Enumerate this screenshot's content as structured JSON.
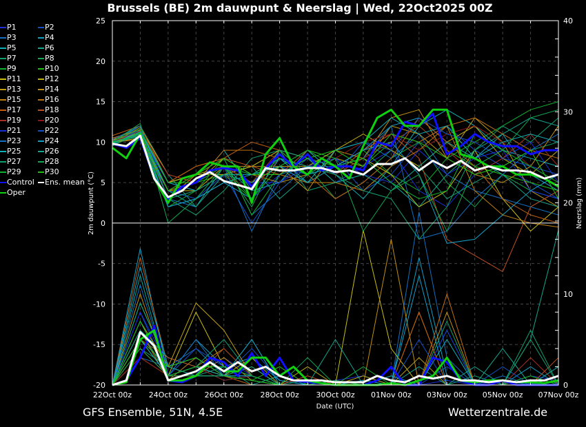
{
  "chart_data": {
    "type": "line",
    "title": "Brussels  (BE)  2m dauwpunt & Neerslag | Wed, 22Oct2025 00Z",
    "xlabel": "Date (UTC)",
    "ylabel": "2m dauwpunt (°C)",
    "y2label": "Neerslag (mm)",
    "ylim": [
      -20,
      25
    ],
    "y2lim": [
      0,
      40
    ],
    "yticks": [
      25,
      20,
      15,
      10,
      5,
      0,
      -5,
      -10,
      -15,
      -20
    ],
    "y2ticks": [
      40,
      30,
      20,
      10,
      0
    ],
    "xticks": [
      "22Oct 00z",
      "24Oct 00z",
      "26Oct 00z",
      "28Oct 00z",
      "30Oct 00z",
      "01Nov 00z",
      "03Nov 00z",
      "05Nov 00z",
      "07Nov 00z"
    ],
    "days": 16,
    "grid": true,
    "legend_position": "left-outside",
    "members": {
      "time_step_h": 24,
      "names": [
        "P1",
        "P2",
        "P3",
        "P4",
        "P5",
        "P6",
        "P7",
        "P8",
        "P9",
        "P10",
        "P11",
        "P12",
        "P13",
        "P14",
        "P15",
        "P16",
        "P17",
        "P18",
        "P19",
        "P20",
        "P21",
        "P22",
        "P23",
        "P24",
        "P25",
        "P26",
        "P27",
        "P28",
        "P29",
        "P30"
      ],
      "colors": [
        "#1a2fd8",
        "#1450c8",
        "#1470c0",
        "#12a0c8",
        "#10b0b8",
        "#10a890",
        "#10a070",
        "#10a850",
        "#10b030",
        "#20c018",
        "#c8c010",
        "#c0b010",
        "#c0a010",
        "#c09010",
        "#c08010",
        "#c07010",
        "#c06010",
        "#c05020",
        "#a83020",
        "#901818",
        "#1a2fd8",
        "#1450c8",
        "#1470c0",
        "#12a0c8",
        "#10b0b8",
        "#10a890",
        "#10a070",
        "#10a850",
        "#10b030",
        "#20c018"
      ],
      "dewpoint": [
        [
          10,
          11,
          4,
          5,
          7,
          3,
          6,
          8,
          5,
          7,
          9,
          4,
          2,
          6,
          8,
          10,
          5
        ],
        [
          10.2,
          11.5,
          3,
          4,
          6,
          5,
          7,
          6,
          8,
          4,
          6,
          10,
          12,
          9,
          7,
          5,
          3
        ],
        [
          9.8,
          12,
          5,
          6,
          8,
          1,
          4,
          7,
          9,
          10,
          8,
          11,
          6,
          4,
          3,
          2,
          1
        ],
        [
          10,
          10.5,
          2,
          3,
          5,
          6,
          8,
          5,
          7,
          9,
          12,
          13,
          10,
          8,
          11,
          6,
          4
        ],
        [
          9.9,
          11,
          4,
          5,
          9,
          4,
          5,
          9,
          6,
          3,
          7,
          12,
          14,
          12,
          9,
          8,
          7
        ],
        [
          10.1,
          12,
          6,
          2,
          6,
          7,
          3,
          6,
          7,
          8,
          5,
          2,
          6,
          9,
          11,
          13,
          12
        ],
        [
          9.7,
          11.2,
          3,
          1,
          4,
          8,
          9,
          4,
          5,
          6,
          9,
          7,
          3,
          5,
          7,
          9,
          10
        ],
        [
          10,
          10.8,
          5,
          6,
          7,
          6,
          8,
          7,
          3,
          5,
          8,
          10,
          5,
          2,
          6,
          4,
          3
        ],
        [
          9.5,
          11.5,
          2,
          4,
          8,
          1,
          6,
          8,
          7,
          9,
          6,
          4,
          8,
          10,
          12,
          14,
          15
        ],
        [
          10,
          11,
          4,
          5,
          6,
          3,
          7,
          9,
          8,
          7,
          10,
          12,
          9,
          7,
          6,
          5,
          4
        ],
        [
          10.3,
          11,
          5,
          6,
          6,
          7,
          9,
          8,
          6,
          8,
          6,
          2,
          4,
          9,
          3,
          -1,
          2
        ],
        [
          10,
          10.5,
          4,
          4,
          7,
          5,
          7,
          7,
          9,
          11,
          9,
          7,
          10,
          12,
          8,
          6,
          9
        ],
        [
          9.8,
          11.8,
          6,
          5,
          8,
          6,
          5,
          6,
          8,
          7,
          12,
          11,
          8,
          13,
          10,
          4,
          2
        ],
        [
          10.2,
          11,
          3,
          6,
          7,
          7,
          7,
          4,
          9,
          8,
          13,
          14,
          8,
          6,
          5,
          7,
          12
        ],
        [
          10.5,
          11.5,
          5,
          7,
          8,
          6,
          6,
          5,
          5,
          4,
          7,
          9,
          12,
          4,
          1,
          0,
          -0.5
        ],
        [
          10,
          10.3,
          4,
          5,
          9,
          9,
          8,
          7,
          6,
          9,
          11,
          10,
          12,
          13,
          11,
          9,
          8
        ],
        [
          10.8,
          12,
          5,
          7,
          8,
          10,
          9,
          6,
          3,
          5,
          8,
          13,
          10,
          7,
          3,
          1,
          0
        ],
        [
          10.5,
          11,
          4,
          6,
          8,
          7,
          6,
          9,
          7,
          9,
          11,
          8,
          -2,
          -4,
          -6,
          2,
          4
        ],
        [
          10,
          11.4,
          6,
          5,
          7,
          5,
          9,
          8,
          6,
          8,
          10,
          12,
          9,
          6,
          8,
          11,
          7
        ],
        [
          10.2,
          10.9,
          3,
          4,
          6,
          4,
          8,
          7,
          8,
          10,
          11,
          9,
          11,
          12,
          10,
          7,
          5
        ],
        [
          10,
          11,
          5,
          4,
          6,
          5,
          5,
          7,
          8,
          6,
          5,
          9,
          6,
          8,
          9,
          4,
          3
        ],
        [
          9.7,
          11.6,
          4,
          3,
          6,
          0,
          5,
          8,
          6,
          10,
          9,
          13,
          11,
          10,
          8,
          7,
          6
        ],
        [
          10.3,
          12,
          3,
          2,
          7,
          -1,
          6,
          7,
          7,
          8,
          12,
          -2,
          -1,
          3,
          6,
          9,
          11
        ],
        [
          10,
          11,
          2,
          3,
          5,
          3,
          8,
          6,
          7,
          9,
          10,
          6,
          -2.5,
          -2,
          1,
          4,
          6
        ],
        [
          9.8,
          11.3,
          5,
          4,
          6,
          6,
          7,
          5,
          9,
          10,
          13,
          11,
          12,
          8,
          10,
          11,
          10
        ],
        [
          10,
          10.7,
          4,
          2,
          7,
          4,
          9,
          8,
          5,
          6,
          4,
          7,
          10,
          8,
          6,
          3,
          2
        ],
        [
          9.6,
          11,
          3,
          4,
          6,
          5,
          8,
          7,
          6,
          4,
          3,
          -2,
          2,
          9,
          12,
          10,
          13
        ],
        [
          10,
          12.3,
          0,
          3,
          7,
          2,
          9,
          6,
          8,
          -1,
          4,
          6,
          -1,
          7,
          9,
          13,
          14
        ],
        [
          10.1,
          11.6,
          5,
          5,
          7,
          3,
          7,
          9,
          7,
          8,
          5,
          3,
          4,
          11,
          9,
          7,
          5
        ],
        [
          9.9,
          11.1,
          4,
          6,
          8,
          6,
          6,
          8,
          9,
          7,
          11,
          10,
          8,
          6,
          7,
          9,
          3
        ]
      ],
      "precip": [
        [
          0,
          5,
          2,
          1,
          3,
          1,
          0,
          0,
          0.5,
          1,
          0,
          0,
          0.5,
          0,
          0,
          1,
          0.5
        ],
        [
          0,
          8,
          1,
          2,
          1,
          4,
          0.5,
          0,
          0,
          0,
          1,
          0,
          2,
          0,
          0.5,
          0,
          0
        ],
        [
          0,
          3,
          2,
          4,
          1,
          0.5,
          0,
          0,
          0.5,
          0,
          0,
          19,
          3,
          0,
          1,
          0,
          0.5
        ],
        [
          0,
          15,
          1,
          5,
          2,
          3,
          0.5,
          0,
          0,
          0.5,
          0,
          14,
          1,
          0,
          0,
          2,
          0
        ],
        [
          0,
          6,
          3,
          2,
          0.5,
          1,
          0,
          0,
          0,
          0,
          1,
          0,
          5,
          0,
          0,
          0,
          1
        ],
        [
          0,
          12,
          1,
          1,
          2,
          0,
          1,
          0,
          0,
          0,
          0,
          2,
          0,
          0,
          4,
          0,
          0
        ],
        [
          0,
          4,
          2,
          1,
          1,
          5,
          0,
          0.5,
          0,
          0,
          0,
          0,
          0,
          1,
          0,
          6,
          0
        ],
        [
          0,
          6,
          0.5,
          3,
          1,
          2,
          0,
          0,
          0.5,
          0,
          0,
          0,
          0,
          0,
          0,
          0,
          0
        ],
        [
          0,
          9,
          2,
          1,
          4,
          1,
          0,
          0,
          0,
          2,
          0,
          0,
          6,
          0,
          0,
          0,
          0.5
        ],
        [
          0,
          7,
          1,
          2,
          1,
          0.5,
          2,
          0,
          0,
          0,
          0,
          0,
          0,
          0,
          0,
          1,
          0
        ],
        [
          0,
          3,
          1,
          8,
          2,
          1,
          0,
          0,
          0,
          17,
          4,
          0,
          0,
          0,
          0,
          0,
          0
        ],
        [
          0,
          5,
          1,
          2,
          1,
          3,
          0,
          2,
          0,
          1,
          0,
          0,
          0,
          0,
          0,
          0,
          0
        ],
        [
          0,
          7,
          2,
          9,
          6,
          1,
          0,
          0,
          0,
          0,
          0,
          3,
          0,
          0,
          0,
          0,
          0
        ],
        [
          0,
          10,
          1,
          1,
          3,
          0.5,
          0,
          0,
          0,
          0,
          16,
          0,
          8,
          0,
          0,
          0,
          0
        ],
        [
          0,
          4,
          1,
          2,
          4,
          1,
          0,
          0,
          0,
          0,
          0,
          8,
          0,
          0,
          0,
          0,
          0
        ],
        [
          0,
          6,
          0.5,
          3,
          1,
          2,
          0,
          0,
          0,
          0,
          0,
          0,
          10,
          0,
          0,
          0,
          0
        ],
        [
          0,
          14,
          2,
          1,
          1,
          0,
          0,
          0,
          0,
          0,
          0,
          8,
          0,
          0,
          0,
          0,
          0
        ],
        [
          0,
          5,
          3,
          2,
          1,
          0.5,
          0,
          1,
          0,
          0,
          0,
          0,
          0,
          0,
          0,
          0,
          3
        ],
        [
          0,
          4,
          1,
          1,
          4,
          1,
          0,
          0,
          0,
          0,
          0,
          0,
          0,
          0,
          0,
          3,
          0
        ],
        [
          0,
          3,
          1,
          2,
          0.5,
          1,
          0,
          0,
          0,
          0,
          0,
          0,
          0,
          0,
          0,
          0,
          0
        ],
        [
          0,
          8,
          2,
          1,
          1,
          1,
          0,
          0,
          0,
          0,
          0,
          0,
          6,
          0,
          0,
          0,
          0
        ],
        [
          0,
          6,
          1,
          4,
          2,
          1,
          0,
          0,
          0,
          0,
          0,
          5,
          0,
          0,
          2,
          0,
          0
        ],
        [
          0,
          11,
          1,
          5,
          1,
          0.5,
          0,
          0,
          0,
          0,
          0,
          0,
          0,
          0,
          0,
          0,
          0
        ],
        [
          0,
          13,
          2,
          3,
          1,
          5,
          0,
          0,
          0,
          0,
          0,
          12,
          0,
          0,
          0,
          0,
          1
        ],
        [
          0,
          5,
          1,
          2,
          1,
          1,
          0,
          0,
          0,
          0,
          0,
          0,
          0,
          0,
          0,
          0,
          2
        ],
        [
          0,
          9,
          2,
          1,
          1,
          2,
          0,
          0,
          5,
          0,
          0,
          0,
          0,
          2,
          0,
          5,
          17
        ],
        [
          0,
          6,
          1,
          2,
          5,
          1,
          0,
          0,
          0,
          0,
          0,
          0,
          7,
          0,
          0,
          5,
          0
        ],
        [
          0,
          4,
          1,
          1,
          1,
          0.5,
          0,
          3,
          0,
          0,
          0,
          0,
          0,
          0,
          0,
          0,
          0
        ],
        [
          0,
          7,
          1,
          2,
          2,
          1,
          0,
          0,
          0,
          0,
          0,
          0,
          0,
          0,
          0,
          0,
          1
        ],
        [
          0,
          5,
          2,
          3,
          1,
          0.5,
          0,
          0,
          0,
          0,
          0,
          0,
          0,
          0,
          0,
          0,
          0
        ]
      ]
    },
    "control": {
      "name": "Control",
      "color": "#1010ff",
      "time_step_h": 12,
      "dewpoint": [
        9.8,
        9.3,
        10.5,
        5.5,
        3,
        4.5,
        5,
        6.5,
        6.8,
        6.5,
        4.5,
        6.8,
        8.5,
        7,
        8.5,
        6.5,
        7,
        7,
        6.5,
        10,
        9.5,
        12.5,
        12,
        13.5,
        8.5,
        9.5,
        11,
        10,
        9.5,
        9.5,
        8.5,
        9,
        9
      ],
      "precip": [
        0,
        0.5,
        3,
        6.5,
        0.5,
        0.3,
        1,
        3,
        2.5,
        1,
        3.5,
        1,
        3,
        0.5,
        0.3,
        0.2,
        0,
        0,
        0,
        0.5,
        2,
        0,
        0,
        3,
        2.5,
        0.5,
        0,
        0,
        0.5,
        0,
        0,
        0,
        0
      ]
    },
    "oper": {
      "name": "Oper",
      "color": "#10d010",
      "time_step_h": 12,
      "dewpoint": [
        9.3,
        8,
        11,
        5.5,
        2.5,
        5.5,
        6,
        7.5,
        7,
        7,
        2.5,
        8.5,
        10.5,
        7,
        6,
        8,
        7,
        5.5,
        9.5,
        13,
        14,
        12,
        12,
        14,
        14,
        8.5,
        8,
        7,
        7,
        6,
        6,
        5.5,
        4.5
      ],
      "precip": [
        0,
        0.3,
        5,
        6,
        0.5,
        0.5,
        1,
        2.5,
        1.5,
        1.5,
        3,
        3,
        1,
        2,
        0.5,
        0.2,
        0,
        0,
        0,
        0,
        0.2,
        0,
        0.5,
        1,
        3,
        0.5,
        0.3,
        0.5,
        0.5,
        0.3,
        0.3,
        0.2,
        0.5
      ]
    },
    "ens_mean": {
      "name": "Ens. mean",
      "color": "#ffffff",
      "time_step_h": 12,
      "dewpoint": [
        9.8,
        9.5,
        10.8,
        5.5,
        3.2,
        4,
        5.5,
        6.3,
        5.2,
        4.7,
        4.2,
        6.8,
        6.5,
        6.5,
        6.8,
        6.8,
        6.3,
        6.5,
        6,
        7.3,
        7.3,
        8,
        6.5,
        7.7,
        6.8,
        7.7,
        6.5,
        7,
        6.5,
        6.5,
        6.3,
        5.5,
        6
      ],
      "precip": [
        0,
        0.5,
        5.8,
        4.3,
        0.5,
        1,
        1.5,
        2.5,
        1.5,
        2.5,
        1.5,
        2,
        1,
        0.5,
        0.5,
        0.5,
        0.3,
        0.3,
        0.3,
        1,
        0.5,
        0.3,
        1,
        0.7,
        1,
        0.5,
        0.5,
        0.3,
        0.5,
        0.3,
        0.5,
        0.5,
        1
      ]
    }
  },
  "footer": {
    "source": "GFS Ensemble, 51N, 4.5E",
    "site": "Wetterzentrale.de"
  }
}
